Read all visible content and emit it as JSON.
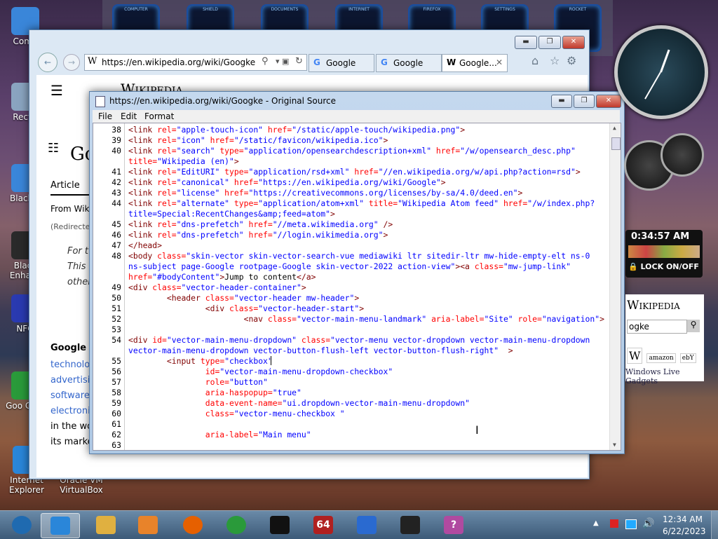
{
  "desktop": {
    "icons": [
      {
        "label": "Comp",
        "color": "#3a86d9"
      },
      {
        "label": "Recyc",
        "color": "#8aa4c0"
      },
      {
        "label": "Black 7",
        "color": "#3a86d9"
      },
      {
        "label": "Black Enhanc",
        "color": "#2a2a2a"
      },
      {
        "label": "NFO",
        "color": "#2a3ab0"
      },
      {
        "label": "Goo Chro",
        "color": "#2a9a3a"
      },
      {
        "label": "Internet Explorer",
        "color": "#2a86d9"
      },
      {
        "label": "Oracle VM VirtualBox",
        "color": "#1a5aa0"
      }
    ]
  },
  "dock": {
    "items": [
      "COMPUTER",
      "SHIELD",
      "DOCUMENTS",
      "INTERNET",
      "FIREFOX",
      "SETTINGS",
      "ROCKET"
    ]
  },
  "browser": {
    "address": "https://en.wikipedia.org/wiki/Googke",
    "tabs": [
      {
        "label": "Google",
        "icon": "google"
      },
      {
        "label": "Google",
        "icon": "google"
      },
      {
        "label": "Google...",
        "icon": "wikipedia"
      }
    ],
    "page": {
      "brand": "Wikipedia",
      "heading": "Go",
      "tab_article": "Article",
      "from": "From Wik",
      "redirected": "(Redirecte",
      "italic": [
        "For t",
        "This",
        "other"
      ],
      "section": "Google",
      "links": [
        "technolo",
        "advertisi",
        "software",
        "electroni"
      ],
      "text": [
        "in the wo",
        "its marke"
      ]
    }
  },
  "source_window": {
    "title": "https://en.wikipedia.org/wiki/Googke - Original Source",
    "menu": [
      "File",
      "Edit",
      "Format"
    ],
    "lines": [
      {
        "n": "38",
        "parts": [
          [
            "t",
            "<link "
          ],
          [
            "a",
            "rel="
          ],
          [
            "v",
            "\"apple-touch-icon\""
          ],
          [
            "a",
            " href="
          ],
          [
            "v",
            "\"/static/apple-touch/wikipedia.png\""
          ],
          [
            "t",
            ">"
          ]
        ]
      },
      {
        "n": "39",
        "parts": [
          [
            "t",
            "<link "
          ],
          [
            "a",
            "rel="
          ],
          [
            "v",
            "\"icon\""
          ],
          [
            "a",
            " href="
          ],
          [
            "v",
            "\"/static/favicon/wikipedia.ico\""
          ],
          [
            "t",
            ">"
          ]
        ]
      },
      {
        "n": "40",
        "parts": [
          [
            "t",
            "<link "
          ],
          [
            "a",
            "rel="
          ],
          [
            "v",
            "\"search\""
          ],
          [
            "a",
            " type="
          ],
          [
            "v",
            "\"application/opensearchdescription+xml\""
          ],
          [
            "a",
            " href="
          ],
          [
            "v",
            "\"/w/opensearch_desc.php\""
          ]
        ]
      },
      {
        "n": "",
        "parts": [
          [
            "a",
            "title="
          ],
          [
            "v",
            "\"Wikipedia (en)\""
          ],
          [
            "t",
            ">"
          ]
        ]
      },
      {
        "n": "41",
        "parts": [
          [
            "t",
            "<link "
          ],
          [
            "a",
            "rel="
          ],
          [
            "v",
            "\"EditURI\""
          ],
          [
            "a",
            " type="
          ],
          [
            "v",
            "\"application/rsd+xml\""
          ],
          [
            "a",
            " href="
          ],
          [
            "v",
            "\"//en.wikipedia.org/w/api.php?action=rsd\""
          ],
          [
            "t",
            ">"
          ]
        ]
      },
      {
        "n": "42",
        "parts": [
          [
            "t",
            "<link "
          ],
          [
            "a",
            "rel="
          ],
          [
            "v",
            "\"canonical\""
          ],
          [
            "a",
            " href="
          ],
          [
            "v",
            "\"https://en.wikipedia.org/wiki/Google\""
          ],
          [
            "t",
            ">"
          ]
        ]
      },
      {
        "n": "43",
        "parts": [
          [
            "t",
            "<link "
          ],
          [
            "a",
            "rel="
          ],
          [
            "v",
            "\"license\""
          ],
          [
            "a",
            " href="
          ],
          [
            "v",
            "\"https://creativecommons.org/licenses/by-sa/4.0/deed.en\""
          ],
          [
            "t",
            ">"
          ]
        ]
      },
      {
        "n": "44",
        "parts": [
          [
            "t",
            "<link "
          ],
          [
            "a",
            "rel="
          ],
          [
            "v",
            "\"alternate\""
          ],
          [
            "a",
            " type="
          ],
          [
            "v",
            "\"application/atom+xml\""
          ],
          [
            "a",
            " title="
          ],
          [
            "v",
            "\"Wikipedia Atom feed\""
          ],
          [
            "a",
            " href="
          ],
          [
            "v",
            "\"/w/index.php?"
          ]
        ]
      },
      {
        "n": "",
        "parts": [
          [
            "v",
            "title=Special:RecentChanges&amp;feed=atom\""
          ],
          [
            "t",
            ">"
          ]
        ]
      },
      {
        "n": "45",
        "parts": [
          [
            "t",
            "<link "
          ],
          [
            "a",
            "rel="
          ],
          [
            "v",
            "\"dns-prefetch\""
          ],
          [
            "a",
            " href="
          ],
          [
            "v",
            "\"//meta.wikimedia.org\""
          ],
          [
            "t",
            " />"
          ]
        ]
      },
      {
        "n": "46",
        "parts": [
          [
            "t",
            "<link "
          ],
          [
            "a",
            "rel="
          ],
          [
            "v",
            "\"dns-prefetch\""
          ],
          [
            "a",
            " href="
          ],
          [
            "v",
            "\"//login.wikimedia.org\""
          ],
          [
            "t",
            ">"
          ]
        ]
      },
      {
        "n": "47",
        "parts": [
          [
            "t",
            "</head>"
          ]
        ]
      },
      {
        "n": "48",
        "parts": [
          [
            "t",
            "<body "
          ],
          [
            "a",
            "class="
          ],
          [
            "v",
            "\"skin-vector skin-vector-search-vue mediawiki ltr sitedir-ltr mw-hide-empty-elt ns-0"
          ]
        ]
      },
      {
        "n": "",
        "parts": [
          [
            "v",
            "ns-subject page-Google rootpage-Google skin-vector-2022 action-view\""
          ],
          [
            "t",
            ">"
          ],
          [
            "t",
            "<a "
          ],
          [
            "a",
            "class="
          ],
          [
            "v",
            "\"mw-jump-link\""
          ]
        ]
      },
      {
        "n": "",
        "parts": [
          [
            "a",
            "href="
          ],
          [
            "v",
            "\"#bodyContent\""
          ],
          [
            "t",
            ">"
          ],
          [
            "x",
            "Jump to content"
          ],
          [
            "t",
            "</a>"
          ]
        ]
      },
      {
        "n": "49",
        "parts": [
          [
            "t",
            "<div "
          ],
          [
            "a",
            "class="
          ],
          [
            "v",
            "\"vector-header-container\""
          ],
          [
            "t",
            ">"
          ]
        ]
      },
      {
        "n": "50",
        "parts": [
          [
            "x",
            "        "
          ],
          [
            "t",
            "<header "
          ],
          [
            "a",
            "class="
          ],
          [
            "v",
            "\"vector-header mw-header\""
          ],
          [
            "t",
            ">"
          ]
        ]
      },
      {
        "n": "51",
        "parts": [
          [
            "x",
            "                "
          ],
          [
            "t",
            "<div "
          ],
          [
            "a",
            "class="
          ],
          [
            "v",
            "\"vector-header-start\""
          ],
          [
            "t",
            ">"
          ]
        ]
      },
      {
        "n": "52",
        "parts": [
          [
            "x",
            "                        "
          ],
          [
            "t",
            "<nav "
          ],
          [
            "a",
            "class="
          ],
          [
            "v",
            "\"vector-main-menu-landmark\""
          ],
          [
            "a",
            " aria-label="
          ],
          [
            "v",
            "\"Site\""
          ],
          [
            "a",
            " role="
          ],
          [
            "v",
            "\"navigation\""
          ],
          [
            "t",
            ">"
          ]
        ]
      },
      {
        "n": "53",
        "parts": []
      },
      {
        "n": "54",
        "parts": [
          [
            "t",
            "<div "
          ],
          [
            "a",
            "id="
          ],
          [
            "v",
            "\"vector-main-menu-dropdown\""
          ],
          [
            "a",
            " class="
          ],
          [
            "v",
            "\"vector-menu vector-dropdown vector-main-menu-dropdown"
          ]
        ]
      },
      {
        "n": "",
        "parts": [
          [
            "v",
            "vector-main-menu-dropdown vector-button-flush-left vector-button-flush-right\""
          ],
          [
            "x",
            "  "
          ],
          [
            "t",
            ">"
          ]
        ]
      },
      {
        "n": "55",
        "parts": [
          [
            "x",
            "        "
          ],
          [
            "t",
            "<input "
          ],
          [
            "a",
            "type="
          ],
          [
            "v",
            "\"checkbox\""
          ]
        ]
      },
      {
        "n": "56",
        "parts": [
          [
            "x",
            "                "
          ],
          [
            "a",
            "id="
          ],
          [
            "v",
            "\"vector-main-menu-dropdown-checkbox\""
          ]
        ]
      },
      {
        "n": "57",
        "parts": [
          [
            "x",
            "                "
          ],
          [
            "a",
            "role="
          ],
          [
            "v",
            "\"button\""
          ]
        ]
      },
      {
        "n": "58",
        "parts": [
          [
            "x",
            "                "
          ],
          [
            "a",
            "aria-haspopup="
          ],
          [
            "v",
            "\"true\""
          ]
        ]
      },
      {
        "n": "59",
        "parts": [
          [
            "x",
            "                "
          ],
          [
            "a",
            "data-event-name="
          ],
          [
            "v",
            "\"ui.dropdown-vector-main-menu-dropdown\""
          ]
        ]
      },
      {
        "n": "60",
        "parts": [
          [
            "x",
            "                "
          ],
          [
            "a",
            "class="
          ],
          [
            "v",
            "\"vector-menu-checkbox \""
          ]
        ]
      },
      {
        "n": "61",
        "parts": []
      },
      {
        "n": "62",
        "parts": [
          [
            "x",
            "                "
          ],
          [
            "a",
            "aria-label="
          ],
          [
            "v",
            "\"Main menu\""
          ]
        ]
      },
      {
        "n": "63",
        "parts": []
      }
    ]
  },
  "gadgets": {
    "clock_time": "0:34:57 AM",
    "lock_label": "LOCK ON/OFF",
    "wiki_title": "Wikipedia",
    "wiki_search": "ogke",
    "live_gadgets": "Windows Live Gadgets",
    "source_icons": [
      "W",
      "amazon",
      "ebY"
    ]
  },
  "taskbar": {
    "time": "12:34 AM",
    "date": "6/22/2023",
    "apps": [
      "start",
      "ie",
      "explorer",
      "media",
      "firefox",
      "chrome",
      "monitor",
      "64",
      "network",
      "black",
      "help"
    ]
  }
}
